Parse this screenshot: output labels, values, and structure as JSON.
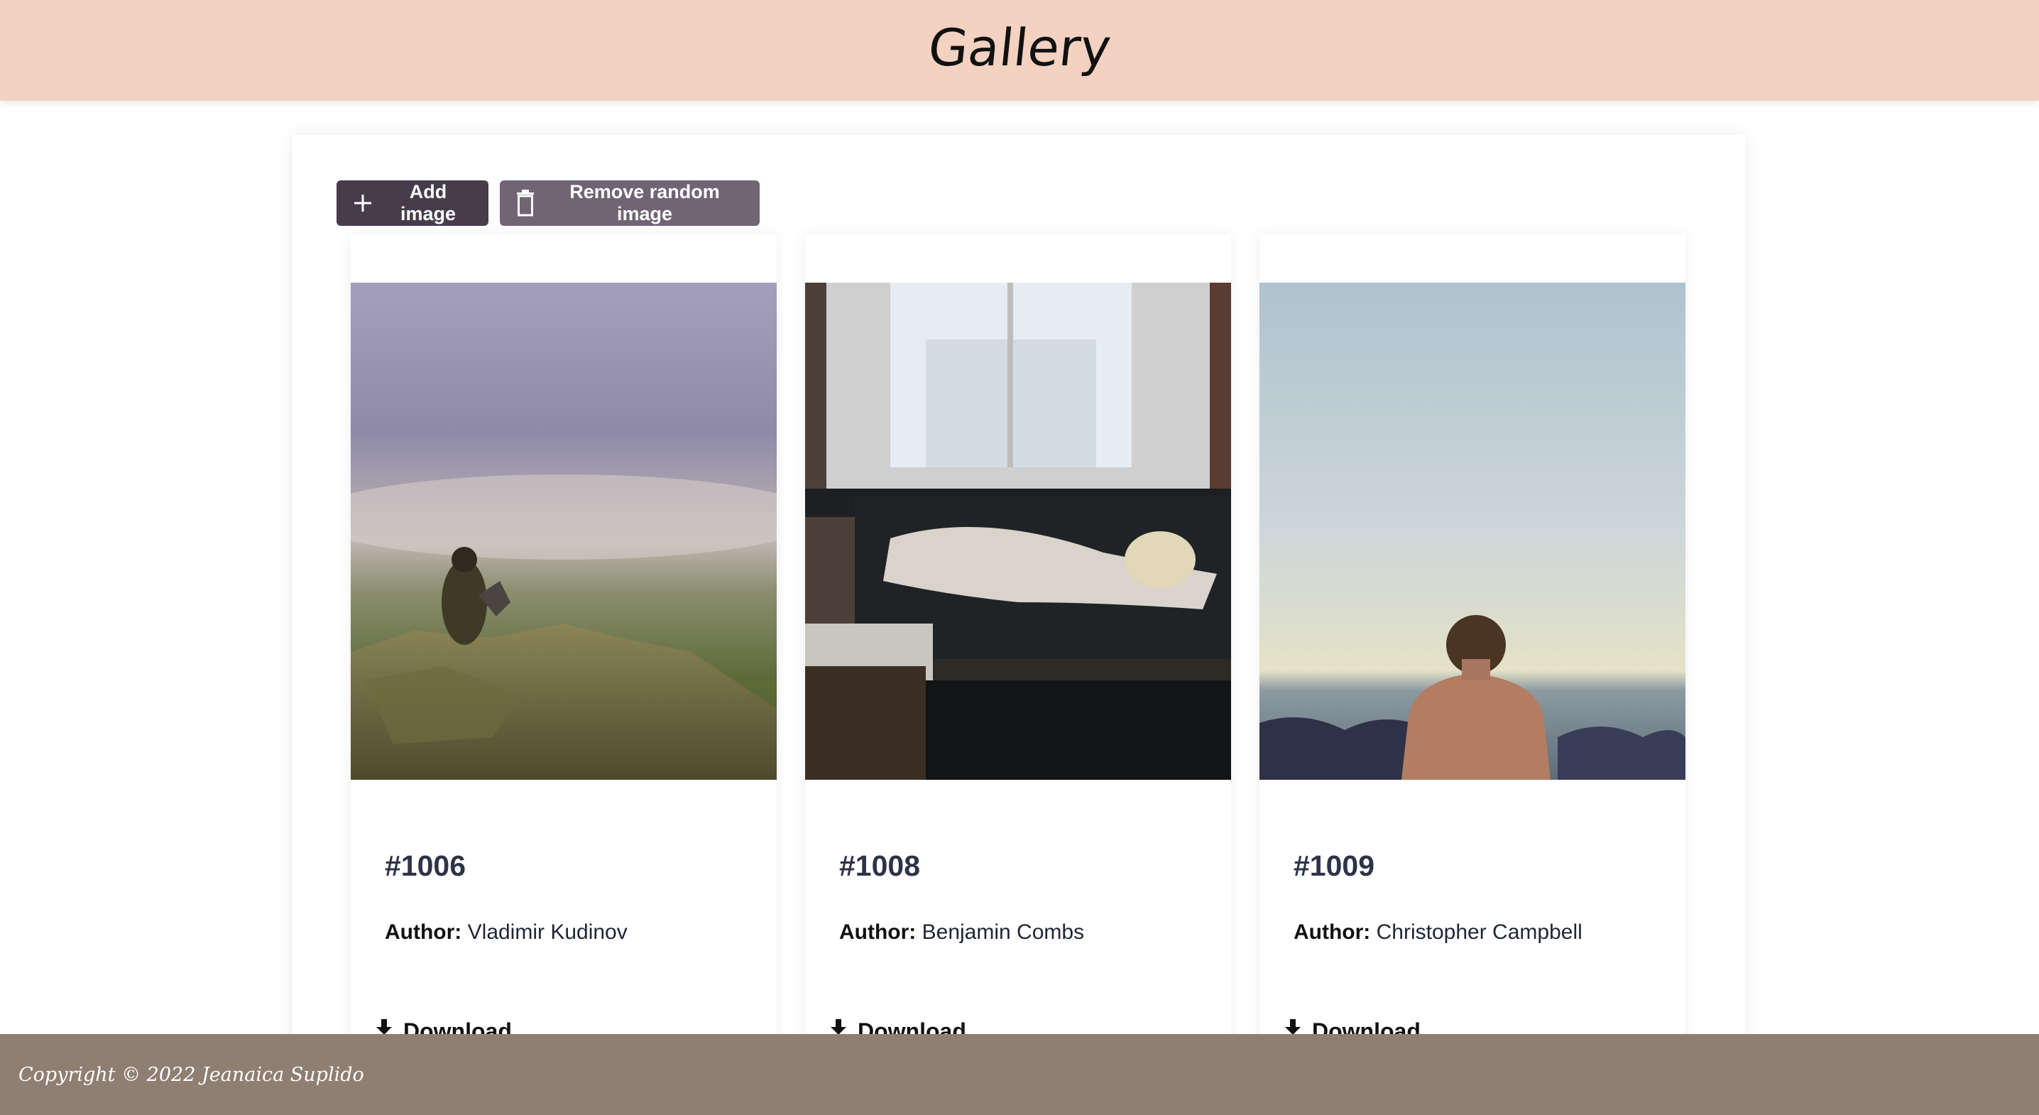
{
  "header": {
    "title": "Gallery"
  },
  "toolbar": {
    "add_label": "Add image",
    "remove_label": "Remove random image"
  },
  "author_label": "Author:",
  "download_label": "Download",
  "cards": [
    {
      "id": "#1006",
      "author": "Vladimir Kudinov"
    },
    {
      "id": "#1008",
      "author": "Benjamin Combs"
    },
    {
      "id": "#1009",
      "author": "Christopher Campbell"
    }
  ],
  "footer": {
    "copyright": "Copyright © 2022 Jeanaica Suplido"
  },
  "colors": {
    "header_bg": "#f3d2c1",
    "footer_bg": "#8f7e72",
    "add_button": "#463c4b",
    "remove_button": "#716474"
  },
  "icons": [
    "plus-icon",
    "trash-icon",
    "download-icon"
  ]
}
